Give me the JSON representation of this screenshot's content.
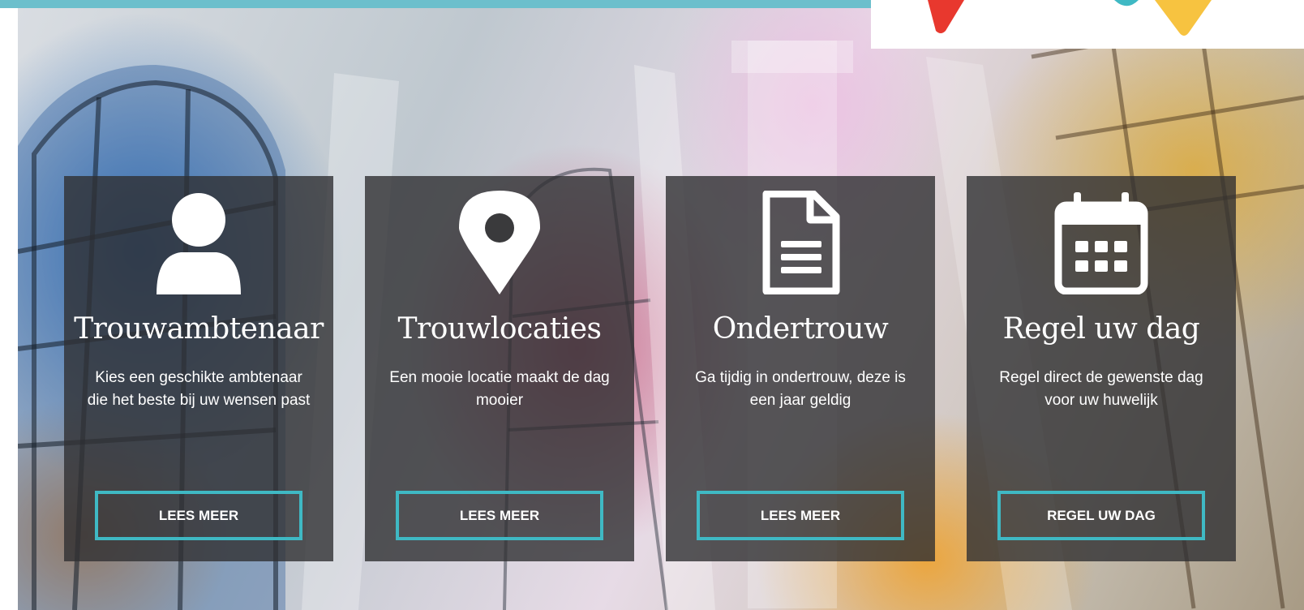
{
  "colors": {
    "top_bar": "#6cbfcc",
    "card_background": "rgba(48,48,50,0.80)",
    "button_border": "#3fb9c4",
    "text": "#ffffff"
  },
  "cards": [
    {
      "icon": "person-icon",
      "title": "Trouwambtenaar",
      "text": "Kies een geschikte ambtenaar die het beste bij uw wensen past",
      "button": "LEES MEER"
    },
    {
      "icon": "map-pin-icon",
      "title": "Trouwlocaties",
      "text": "Een mooie locatie maakt de dag mooier",
      "button": "LEES MEER"
    },
    {
      "icon": "document-icon",
      "title": "Ondertrouw",
      "text": "Ga tijdig in ondertrouw, deze is een jaar geldig",
      "button": "LEES MEER"
    },
    {
      "icon": "calendar-icon",
      "title": "Regel uw dag",
      "text": "Regel direct de gewenste dag voor uw huwelijk",
      "button": "REGEL UW DAG"
    }
  ]
}
